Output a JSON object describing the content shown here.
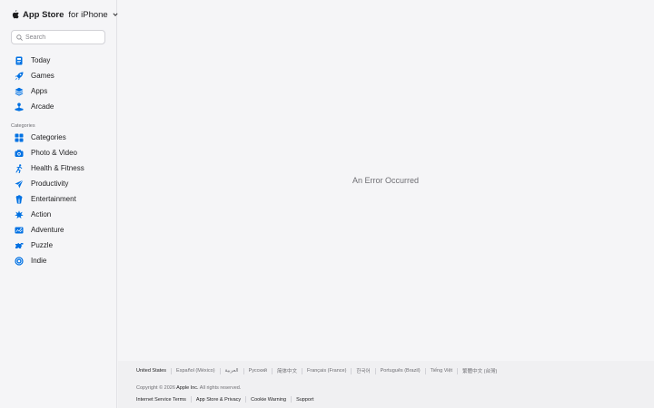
{
  "brand": {
    "name": "App Store",
    "platform": "for iPhone"
  },
  "search": {
    "placeholder": "Search"
  },
  "nav": [
    {
      "label": "Today",
      "icon": "today-icon"
    },
    {
      "label": "Games",
      "icon": "rocket-icon"
    },
    {
      "label": "Apps",
      "icon": "layers-icon"
    },
    {
      "label": "Arcade",
      "icon": "joystick-icon"
    }
  ],
  "categories_heading": "Categories",
  "categories": [
    {
      "label": "Categories",
      "icon": "grid-icon"
    },
    {
      "label": "Photo & Video",
      "icon": "camera-icon"
    },
    {
      "label": "Health & Fitness",
      "icon": "runner-icon"
    },
    {
      "label": "Productivity",
      "icon": "paper-plane-icon"
    },
    {
      "label": "Entertainment",
      "icon": "popcorn-icon"
    },
    {
      "label": "Action",
      "icon": "burst-icon"
    },
    {
      "label": "Adventure",
      "icon": "map-icon"
    },
    {
      "label": "Puzzle",
      "icon": "puzzle-icon"
    },
    {
      "label": "Indie",
      "icon": "target-icon"
    }
  ],
  "main": {
    "error_message": "An Error Occurred"
  },
  "footer": {
    "locales": [
      "United States",
      "Español (México)",
      "العربية",
      "Русский",
      "简体中文",
      "Français (France)",
      "한국어",
      "Português (Brazil)",
      "Tiếng Việt",
      "繁體中文 (台灣)"
    ],
    "copyright_prefix": "Copyright © 2026 ",
    "copyright_company": "Apple Inc.",
    "copyright_suffix": " All rights reserved.",
    "legal_links": [
      "Internet Service Terms",
      "App Store & Privacy",
      "Cookie Warning",
      "Support"
    ]
  },
  "colors": {
    "accent": "#0071e3",
    "background": "#f5f5f7",
    "footer_background": "#f0f0f2",
    "text": "#1d1d1f",
    "secondary_text": "#6e6e73"
  }
}
